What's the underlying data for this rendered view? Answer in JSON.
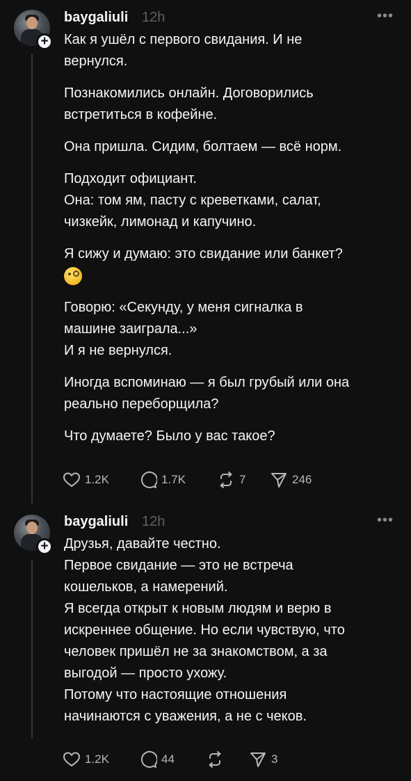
{
  "posts": [
    {
      "username": "baygaliuli",
      "time": "12h",
      "more": "•••",
      "lines": {
        "p1a": "Как я ушёл с первого свидания. И не",
        "p1b": "вернулся.",
        "p2a": "Познакомились онлайн. Договорились",
        "p2b": "встретиться в кофейне.",
        "p3": "Она пришла. Сидим, болтаем — всё норм.",
        "p4": "Подходит официант.",
        "p5a": "Она: том ям, пасту с креветками, салат,",
        "p5b": "чизкейк, лимонад и капучино.",
        "p6": "Я сижу и думаю: это свидание или банкет?",
        "p7a": "Говорю: «Секунду, у меня сигналка в",
        "p7b": "машине заиграла...»",
        "p8": "И я не вернулся.",
        "p9a": "Иногда вспоминаю — я был грубый или она",
        "p9b": "реально переборщила?",
        "p10": "Что думаете? Было у вас такое?"
      },
      "emoji": "face-with-monocle",
      "stats": {
        "likes": "1.2K",
        "comments": "1.7K",
        "reposts": "7",
        "shares": "246"
      }
    },
    {
      "username": "baygaliuli",
      "time": "12h",
      "more": "•••",
      "lines": {
        "l1": "Друзья, давайте честно.",
        "l2": "Первое свидание — это не встреча",
        "l3": "кошельков, а намерений.",
        "l4": "Я всегда открыт к новым людям и верю в",
        "l5": "искреннее общение. Но если чувствую, что",
        "l6": "человек пришёл не за знакомством, а за",
        "l7": "выгодой — просто ухожу.",
        "l8": "Потому что настоящие отношения",
        "l9": "начинаются с уважения, а не с чеков."
      },
      "stats": {
        "likes": "1.2K",
        "comments": "44",
        "reposts": "",
        "shares": "3"
      }
    }
  ],
  "colors": {
    "background": "#101010",
    "text": "#f3f5f7",
    "muted": "#616161",
    "icon": "#b8b8b8"
  }
}
